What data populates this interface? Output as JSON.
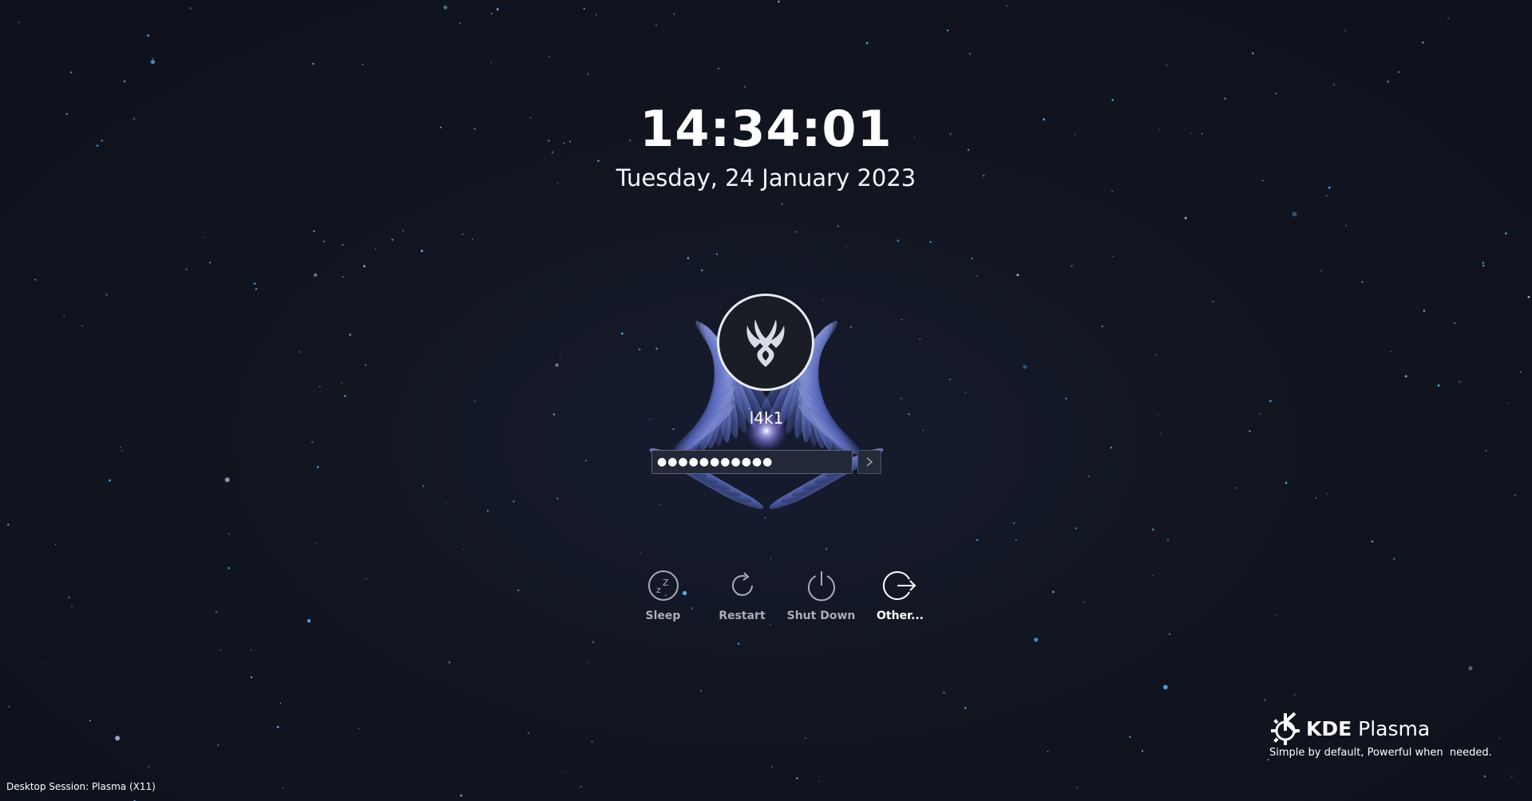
{
  "lockscreen": {
    "time": "14:34:01",
    "date": "Tuesday, 24 January 2023",
    "username": "l4k1",
    "password_masked": "●●●●●●●●●●●",
    "submit_icon": "chevron-right-icon"
  },
  "power_actions": [
    {
      "label": "Sleep",
      "icon": "sleep-icon"
    },
    {
      "label": "Restart",
      "icon": "restart-icon"
    },
    {
      "label": "Shut Down",
      "icon": "power-icon"
    },
    {
      "label": "Other...",
      "icon": "logout-icon"
    }
  ],
  "footer": {
    "session": "Desktop Session: Plasma (X11)"
  },
  "branding": {
    "name_bold": "KDE",
    "name_regular": " Plasma",
    "tagline": "Simple by default, Powerful when  needed."
  },
  "colors": {
    "background": "#10131f",
    "wing_blue": "#7f8fe0",
    "star_blue": "#55b6ff",
    "muted_label": "#a9adb9"
  }
}
